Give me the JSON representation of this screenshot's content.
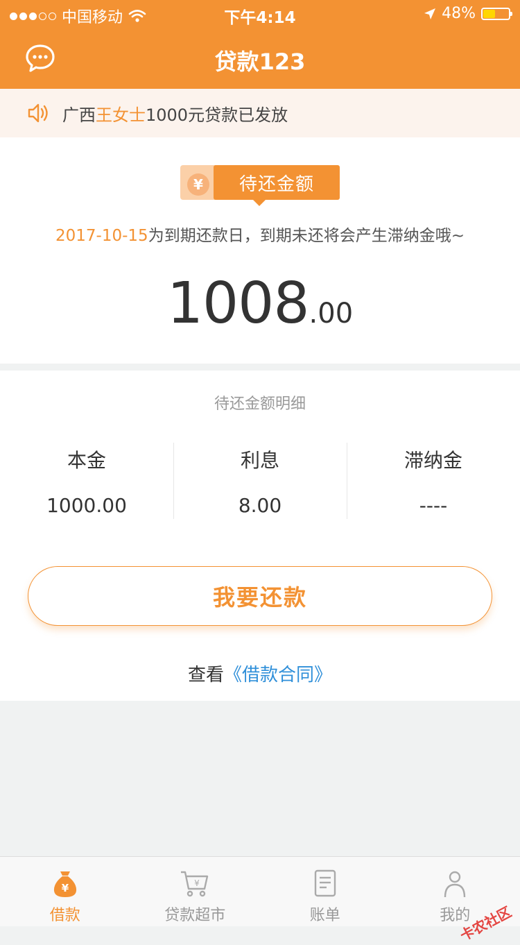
{
  "status_bar": {
    "carrier": "中国移动",
    "time": "下午4:14",
    "battery": "48%"
  },
  "nav": {
    "title": "贷款123"
  },
  "notice": {
    "prefix": "广西",
    "highlight": "王女士",
    "suffix": "1000元贷款已发放"
  },
  "due_card": {
    "badge": "待还金额",
    "coin_symbol": "¥",
    "due_date": "2017-10-15",
    "due_text": "为到期还款日，到期未还将会产生滞纳金哦~",
    "amount_int": "1008",
    "amount_dec": ".00"
  },
  "detail": {
    "title": "待还金额明细",
    "columns": [
      {
        "label": "本金",
        "value": "1000.00"
      },
      {
        "label": "利息",
        "value": "8.00"
      },
      {
        "label": "滞纳金",
        "value": "----"
      }
    ]
  },
  "repay_button": "我要还款",
  "contract": {
    "prefix": "查看",
    "link": "《借款合同》"
  },
  "tabbar": {
    "items": [
      {
        "label": "借款",
        "icon": "money-bag-icon",
        "active": true
      },
      {
        "label": "贷款超市",
        "icon": "shopping-cart-icon",
        "active": false
      },
      {
        "label": "账单",
        "icon": "bill-icon",
        "active": false
      },
      {
        "label": "我的",
        "icon": "user-icon",
        "active": false
      }
    ]
  },
  "watermark": "卡农社区",
  "colors": {
    "accent": "#f39233",
    "link": "#2f8fd9",
    "notice_bg": "#fcf3ed"
  }
}
